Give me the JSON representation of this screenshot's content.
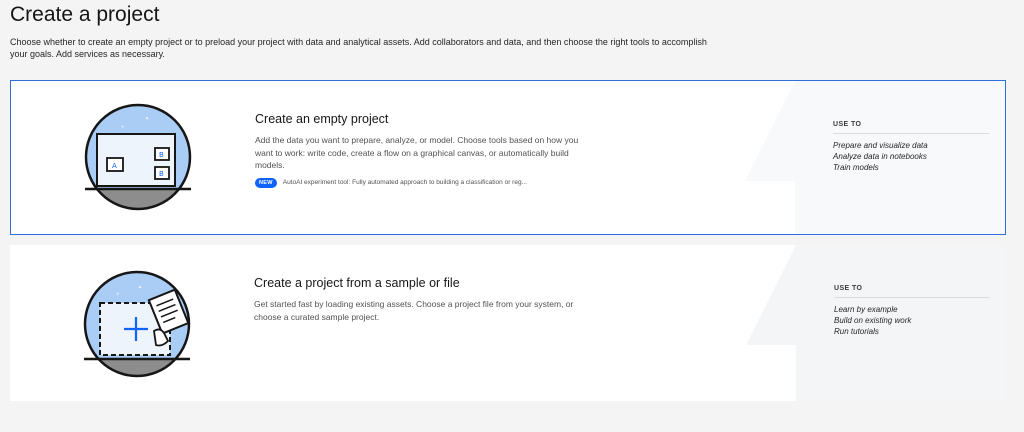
{
  "page": {
    "title": "Create a project",
    "description": "Choose whether to create an empty project or to preload your project with data and analytical assets. Add collaborators and data, and then choose the right tools to accomplish your goals. Add services as necessary."
  },
  "cards": [
    {
      "title": "Create an empty project",
      "description": "Add the data you want to prepare, analyze, or model. Choose tools based on how you want to work: write code, create a flow on a graphical canvas, or automatically build models.",
      "badge": "NEW",
      "badge_text": "AutoAI experiment tool: Fully automated approach to building a classification or reg...",
      "usage_heading": "USE TO",
      "usage_items": [
        "Prepare and visualize data",
        "Analyze data in notebooks",
        "Train models"
      ],
      "selected": true,
      "icon": "empty-project-illustration"
    },
    {
      "title": "Create a project from a sample or file",
      "description": "Get started fast by loading existing assets. Choose a project file from your system, or choose a curated sample project.",
      "usage_heading": "USE TO",
      "usage_items": [
        "Learn by example",
        "Build on existing work",
        "Run tutorials"
      ],
      "selected": false,
      "icon": "sample-project-illustration"
    }
  ],
  "colors": {
    "accent": "#0f62fe",
    "selected_border": "#2f6fd8",
    "illustration_sky": "#a9cdf5",
    "illustration_ground": "#8d8d8d"
  }
}
